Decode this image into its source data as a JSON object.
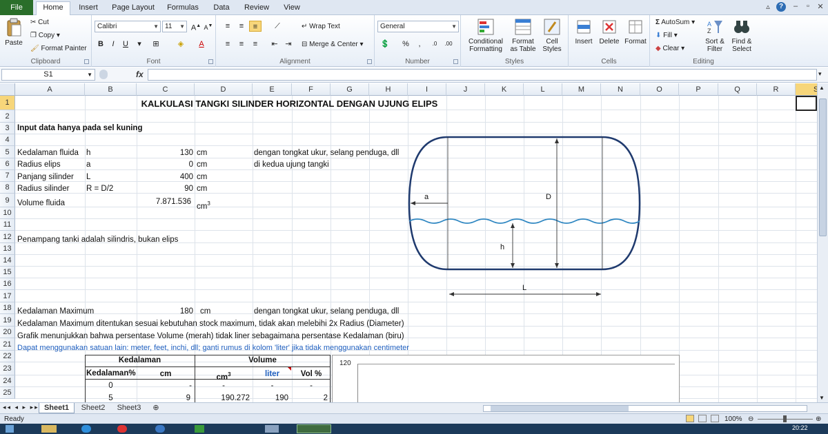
{
  "tabs": {
    "file": "File",
    "items": [
      "Home",
      "Insert",
      "Page Layout",
      "Formulas",
      "Data",
      "Review",
      "View"
    ]
  },
  "ribbon": {
    "clipboard": {
      "label": "Clipboard",
      "paste": "Paste",
      "cut": "Cut",
      "copy": "Copy",
      "format_painter": "Format Painter"
    },
    "font": {
      "label": "Font",
      "name": "Calibri",
      "size": "11",
      "bold": "B",
      "italic": "I",
      "underline": "U"
    },
    "alignment": {
      "label": "Alignment",
      "wrap_text": "Wrap Text",
      "merge_center": "Merge & Center"
    },
    "number": {
      "label": "Number",
      "format": "General"
    },
    "styles": {
      "label": "Styles",
      "conditional": "Conditional Formatting",
      "format_table": "Format as Table",
      "cell_styles": "Cell Styles"
    },
    "cells": {
      "label": "Cells",
      "insert": "Insert",
      "delete": "Delete",
      "format": "Format"
    },
    "editing": {
      "label": "Editing",
      "autosum": "AutoSum",
      "fill": "Fill",
      "clear": "Clear",
      "sort_filter": "Sort & Filter",
      "find_select": "Find & Select"
    }
  },
  "formula_bar": {
    "name_box": "S1",
    "fx": "fx"
  },
  "columns": [
    "A",
    "B",
    "C",
    "D",
    "E",
    "F",
    "G",
    "H",
    "I",
    "J",
    "K",
    "L",
    "M",
    "N",
    "O",
    "P",
    "Q",
    "R",
    "S"
  ],
  "rows": [
    "1",
    "2",
    "3",
    "4",
    "5",
    "6",
    "7",
    "8",
    "9",
    "10",
    "11",
    "12",
    "13",
    "14",
    "15",
    "16",
    "17",
    "18",
    "19",
    "20",
    "21",
    "22",
    "23",
    "24",
    "25"
  ],
  "sheet": {
    "title": "KALKULASI TANGKI SILINDER HORIZONTAL DENGAN UJUNG ELIPS",
    "note_input": "Input data hanya pada sel kuning",
    "r5": {
      "label": "Kedalaman fluida",
      "sym": "h",
      "value": "130",
      "unit": "cm",
      "note": "dengan tongkat ukur, selang penduga, dll"
    },
    "r6": {
      "label": "Radius elips",
      "sym": "a",
      "value": "0",
      "unit": "cm",
      "note": "di kedua ujung tangki"
    },
    "r7": {
      "label": "Panjang silinder",
      "sym": "L",
      "value": "400",
      "unit": "cm"
    },
    "r8": {
      "label": "Radius silinder",
      "sym": "R = D/2",
      "value": "90",
      "unit": "cm"
    },
    "r9": {
      "label": "Volume fluida",
      "value": "7.871.536",
      "unit": "cm",
      "unit_sup": "3"
    },
    "r12": "Penampang tanki adalah silindris, bukan elips",
    "r18": {
      "label": "Kedalaman Maximum",
      "value": "180",
      "unit": "cm",
      "note": "dengan tongkat ukur, selang penduga, dll"
    },
    "r19": "Kedalaman Maximum ditentukan sesuai kebutuhan stock maximum, tidak akan melebihi 2x Radius (Diameter)",
    "r20": "Grafik menunjukkan bahwa persentase Volume (merah) tidak liner sebagaimana persentase Kedalaman (biru)",
    "r21": "Dapat menggunakan satuan lain: meter, feet, inchi, dll; ganti rumus di kolom 'liter' jika tidak menggunakan centimeter",
    "table": {
      "h_kedalaman": "Kedalaman",
      "h_volume": "Volume",
      "c_pct": "Kedalaman%",
      "c_cm": "cm",
      "c_cm3": "cm",
      "c_cm3_sup": "3",
      "c_liter": "liter",
      "c_volpct": "Vol %",
      "r24": [
        "0",
        "-",
        "-",
        "-",
        "-"
      ],
      "r25": [
        "5",
        "9",
        "190.272",
        "190",
        "2"
      ]
    },
    "chart_axis_top": "120"
  },
  "diagram": {
    "label_a": "a",
    "label_D": "D",
    "label_h": "h",
    "label_L": "L"
  },
  "sheets": [
    "Sheet1",
    "Sheet2",
    "Sheet3"
  ],
  "status": {
    "ready": "Ready",
    "zoom": "100%",
    "time": "20:22"
  },
  "colors": {
    "file_tab": "#2a6e2a",
    "accent_blue": "#1f5fbf",
    "selection": "#f7d67a"
  }
}
